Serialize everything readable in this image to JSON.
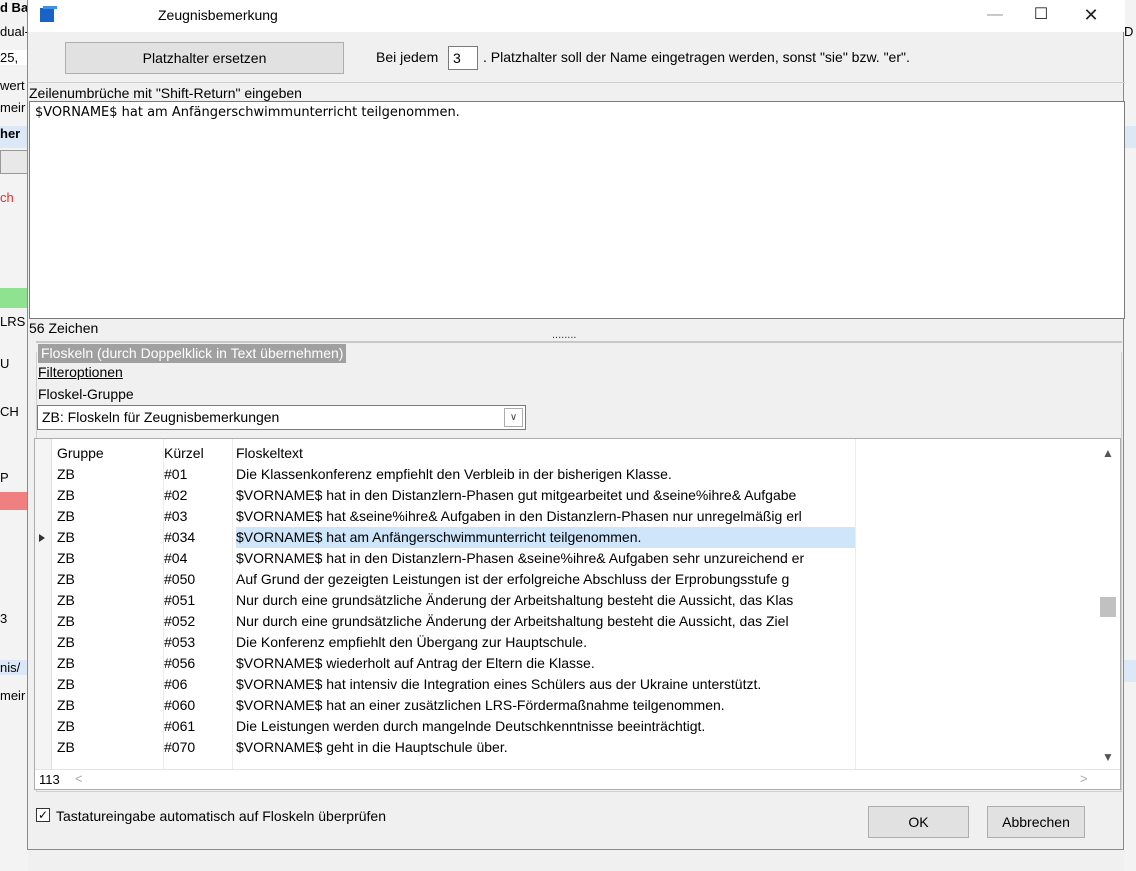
{
  "background_app": {
    "left_fragments": [
      "d Ba",
      "dual-",
      "25,",
      "wert",
      "meir",
      "her",
      "ch",
      "LRS",
      "U",
      "CH",
      "P",
      "3",
      "nis/",
      "meir"
    ],
    "right_fragments": [
      "D"
    ]
  },
  "window": {
    "title": "Zeugnisbemerkung",
    "minimize": "—",
    "maximize": "☐",
    "close": "✕"
  },
  "toolbar": {
    "replace_button": "Platzhalter ersetzen",
    "every_label": "Bei jedem",
    "every_value": "3",
    "hint": ". Platzhalter soll der Name eingetragen werden, sonst \"sie\" bzw. \"er\"."
  },
  "editor": {
    "hint": "Zeilenumbrüche mit \"Shift-Return\" eingeben",
    "text": "$VORNAME$ hat am Anfängerschwimmunterricht teilgenommen.",
    "char_count": "56 Zeichen"
  },
  "splitter": "........",
  "floskeln": {
    "group_title": "Floskeln (durch Doppelklick in Text übernehmen)",
    "filter_link": "Filteroptionen",
    "group_label": "Floskel-Gruppe",
    "group_value": "ZB: Floskeln für Zeugnisbemerkungen",
    "columns": [
      "Gruppe",
      "Kürzel",
      "Floskeltext"
    ],
    "rows": [
      [
        "ZB",
        "#01",
        "Die Klassenkonferenz empfiehlt den Verbleib in der bisherigen Klasse."
      ],
      [
        "ZB",
        "#02",
        "$VORNAME$ hat in den Distanzlern-Phasen gut mitgearbeitet und &seine%ihre& Aufgabe"
      ],
      [
        "ZB",
        "#03",
        "$VORNAME$ hat &seine%ihre& Aufgaben in den Distanzlern-Phasen nur unregelmäßig erl"
      ],
      [
        "ZB",
        "#034",
        "$VORNAME$ hat am Anfängerschwimmunterricht teilgenommen."
      ],
      [
        "ZB",
        "#04",
        "$VORNAME$ hat in den Distanzlern-Phasen &seine%ihre& Aufgaben sehr unzureichend er"
      ],
      [
        "ZB",
        "#050",
        "Auf Grund der gezeigten Leistungen ist der erfolgreiche Abschluss der Erprobungsstufe g"
      ],
      [
        "ZB",
        "#051",
        "Nur durch eine grundsätzliche Änderung der Arbeitshaltung besteht die Aussicht, das Klas"
      ],
      [
        "ZB",
        "#052",
        "Nur durch eine grundsätzliche Änderung der Arbeitshaltung besteht die Aussicht, das Ziel"
      ],
      [
        "ZB",
        "#053",
        "Die Konferenz empfiehlt den Übergang zur Hauptschule."
      ],
      [
        "ZB",
        "#056",
        "$VORNAME$ wiederholt auf Antrag der Eltern die Klasse."
      ],
      [
        "ZB",
        "#06",
        "$VORNAME$ hat intensiv die Integration eines Schülers aus der Ukraine unterstützt."
      ],
      [
        "ZB",
        "#060",
        "$VORNAME$ hat an einer zusätzlichen LRS-Fördermaßnahme teilgenommen."
      ],
      [
        "ZB",
        "#061",
        "Die Leistungen werden durch mangelnde Deutschkenntnisse beeinträchtigt."
      ],
      [
        "ZB",
        "#070",
        "$VORNAME$ geht in die Hauptschule über."
      ]
    ],
    "selected_row": 3,
    "count": "113"
  },
  "footer": {
    "auto_check_label": "Tastatureingabe automatisch auf Floskeln überprüfen",
    "auto_check_checked": true,
    "ok": "OK",
    "cancel": "Abbrechen"
  },
  "colors": {
    "selection": "#cfe5fa",
    "dialog_bg": "#f0f0f0",
    "title_icon": "#1a63c6",
    "group_legend_bg": "#a0a0a0"
  }
}
